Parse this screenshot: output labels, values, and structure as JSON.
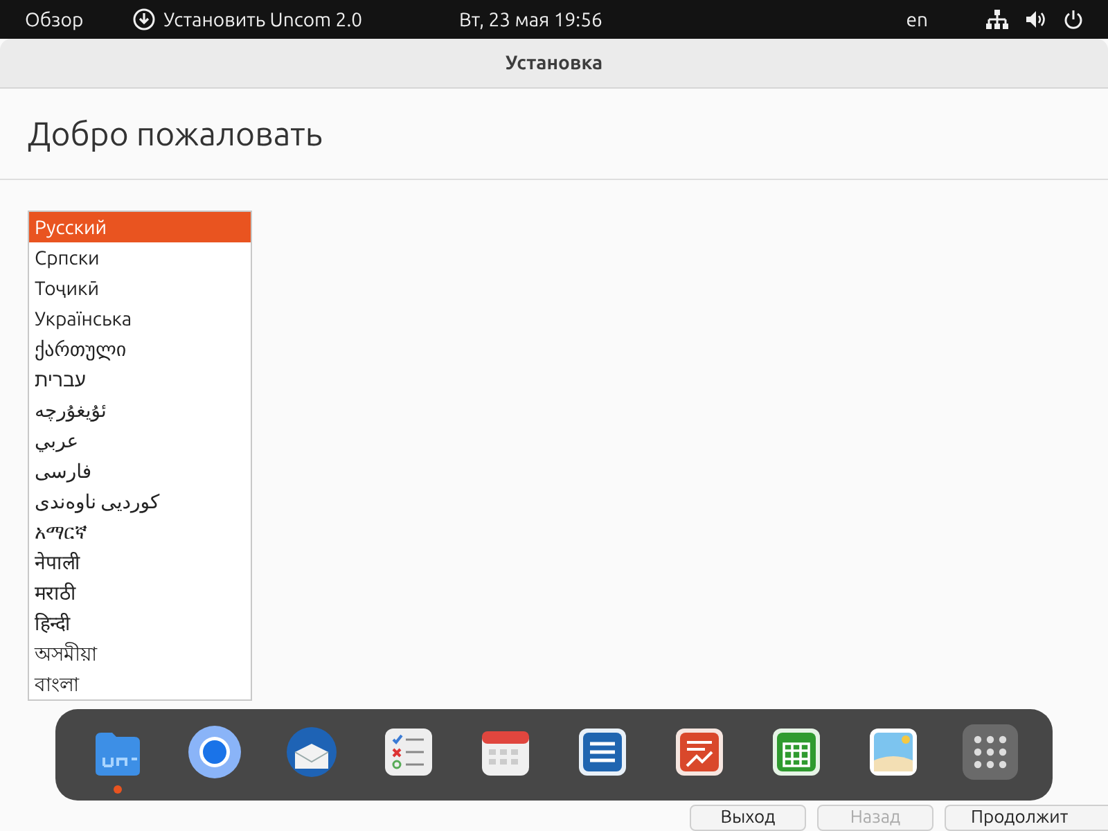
{
  "top_bar": {
    "overview": "Обзор",
    "app": "Установить Uncom 2.0",
    "clock": "Вт, 23 мая  19:56",
    "keyboard_layout": "en"
  },
  "window": {
    "title": "Установка",
    "heading": "Добро пожаловать"
  },
  "languages": [
    {
      "label": "Русский",
      "selected": true
    },
    {
      "label": "Српски",
      "selected": false
    },
    {
      "label": "Тоҷикӣ",
      "selected": false
    },
    {
      "label": "Українська",
      "selected": false
    },
    {
      "label": "ქართული",
      "selected": false
    },
    {
      "label": "עברית",
      "selected": false
    },
    {
      "label": "ئۇيغۇرچە",
      "selected": false
    },
    {
      "label": "عربي",
      "selected": false
    },
    {
      "label": "فارسی",
      "selected": false
    },
    {
      "label": "کوردیی ناوەندی",
      "selected": false
    },
    {
      "label": "አማርኛ",
      "selected": false
    },
    {
      "label": "नेपाली",
      "selected": false
    },
    {
      "label": "मराठी",
      "selected": false
    },
    {
      "label": "हिन्दी",
      "selected": false
    },
    {
      "label": "অসমীয়া",
      "selected": false
    },
    {
      "label": "বাংলা",
      "selected": false
    }
  ],
  "buttons": [
    {
      "label": "Выход",
      "disabled": false
    },
    {
      "label": "Назад",
      "disabled": true
    },
    {
      "label": "Продолжит",
      "disabled": false
    }
  ],
  "dock": [
    {
      "kind": "files",
      "running": true
    },
    {
      "kind": "browser",
      "running": false
    },
    {
      "kind": "mail",
      "running": false
    },
    {
      "kind": "tasks",
      "running": false
    },
    {
      "kind": "calendar",
      "running": false
    },
    {
      "kind": "writer",
      "running": false
    },
    {
      "kind": "impress",
      "running": false
    },
    {
      "kind": "calc",
      "running": false
    },
    {
      "kind": "photos",
      "running": false
    },
    {
      "kind": "apps",
      "running": false
    }
  ]
}
